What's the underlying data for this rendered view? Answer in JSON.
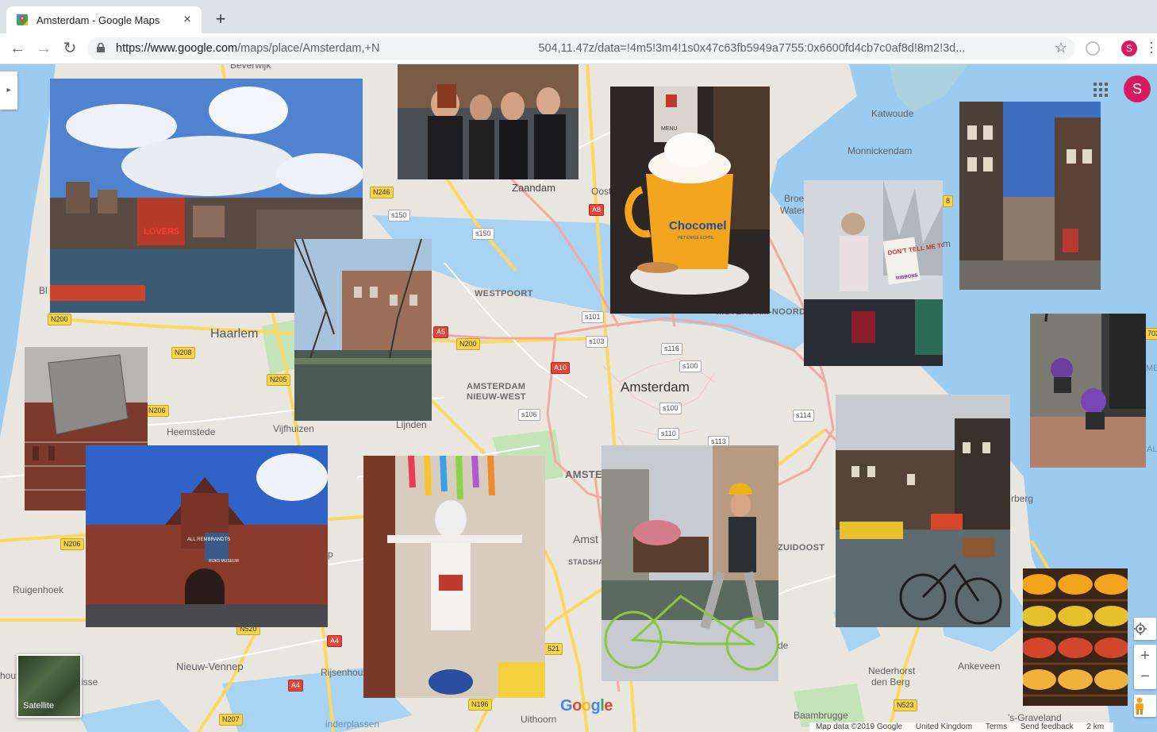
{
  "browser": {
    "tab_title": "Amsterdam - Google Maps",
    "tab_close": "×",
    "new_tab": "+",
    "url_host": "https://www.google.com",
    "url_path": "/maps/place/Amsterdam,+N",
    "url_tail": "504,11.47z/data=!4m5!3m4!1s0x47c63fb5949a7755:0x6600fd4cb7c0af8d!8m2!3d...",
    "back_icon": "←",
    "forward_icon": "→",
    "reload_icon": "↻",
    "star_icon": "☆",
    "profile_initial": "S"
  },
  "map": {
    "labels": {
      "beverwijk": "Beverwijk",
      "zaandam": "Zaandam",
      "oost": "Oost",
      "katwoude": "Katwoude",
      "monnickendam": "Monnickendam",
      "broek": "Broe",
      "water": "Water",
      "westpoort": "WESTPOORT",
      "haarlem": "Haarlem",
      "amsterdam": "Amsterdam",
      "nieuw_west_1": "AMSTERDAM",
      "nieuw_west_2": "NIEUW-WEST",
      "noord": "MSTERDAM-NOORD",
      "heemstede": "Heemstede",
      "vijfhuizen": "Vijfhuizen",
      "lijnden": "Lijnden",
      "amste": "AMSTE",
      "amst": "Amst",
      "stadsha": "STADSHA",
      "zuidoost": "ZUIDOOST",
      "ruigenhoek": "Ruigenhoek",
      "nieuw_vennep": "Nieuw-Vennep",
      "rijsenhout": "Rijsenhou",
      "hou": "hou",
      "isse": "isse",
      "uithoorn": "Uithoorn",
      "nederhorst_1": "Nederhorst",
      "nederhorst_2": "den Berg",
      "ankeveen": "Ankeveen",
      "baambrugge": "Baambrugge",
      "graveland": "'s-Graveland",
      "rberg": "rberg",
      "de": "de",
      "m": "m",
      "bl": "Bl",
      "p": "p",
      "ijmeer_al": "AL",
      "me": "ME",
      "plassen": "inderplassen"
    },
    "shields": {
      "n246": "N246",
      "s150a": "s150",
      "s150b": "s150",
      "a8": "A8",
      "n200a": "N200",
      "n208": "N208",
      "n205": "N205",
      "n206a": "N206",
      "n206b": "N206",
      "a5": "A5",
      "n200b": "N200",
      "s101": "s101",
      "s103": "s103",
      "a10": "A10",
      "s116": "s116",
      "s100a": "s100",
      "s100b": "s100",
      "s106": "s106",
      "s110": "s110",
      "s113": "s113",
      "s114": "s114",
      "a4a": "A4",
      "a4b": "A4",
      "n520": "N520",
      "n196": "N196",
      "n207": "N207",
      "n521": "521",
      "n523": "N523",
      "n702": "702",
      "n8": "8"
    },
    "satellite_label": "Satellite",
    "google_logo": [
      "G",
      "o",
      "o",
      "g",
      "l",
      "e"
    ],
    "attribution": {
      "map_data": "Map data ©2019 Google",
      "region": "United Kingdom",
      "terms": "Terms",
      "feedback": "Send feedback",
      "scale": "2 km"
    },
    "zoom_in": "+",
    "zoom_out": "−"
  },
  "photos": {
    "cup_text": "Chocomel",
    "cup_subtext": "HET ENIGE ECHTE",
    "menu_text": "MENU",
    "sign_text": "DON'T TELL ME TO SMILE",
    "sign_tag": "RIBBONS",
    "museum_banner": "ALL REMBRANDTS",
    "museum_sign": "RIJKS MUSEUM",
    "boat_text": "LOVERS"
  },
  "colors": {
    "accent_profile": "#d81b60",
    "water": "#9ccbf0",
    "land": "#e9e6df",
    "road_yellow": "#fcd860",
    "road_red": "#f0a9a3"
  }
}
